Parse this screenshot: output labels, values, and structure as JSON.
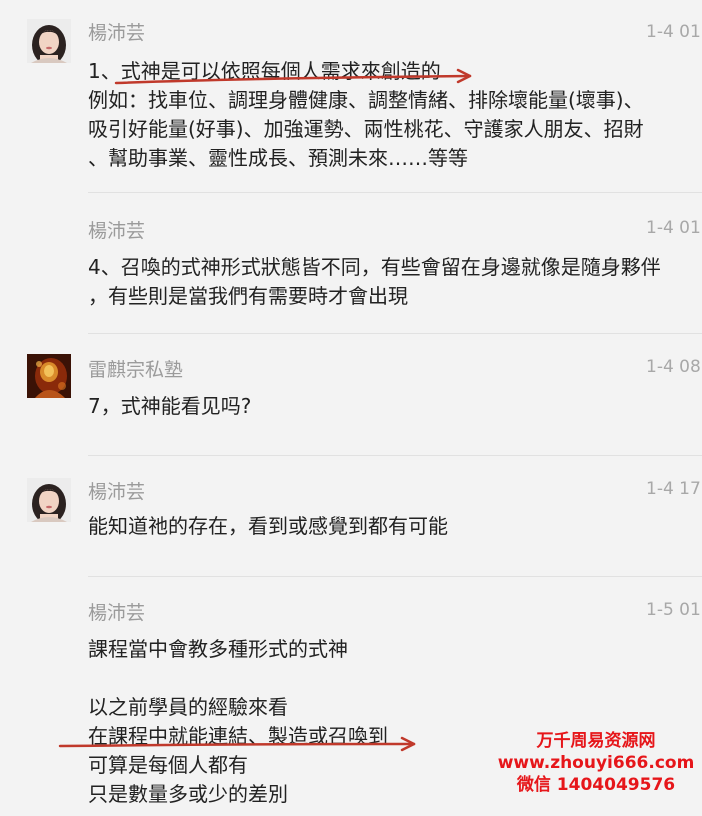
{
  "colors": {
    "background": "#f3f3f3",
    "sender": "#9b9b9b",
    "text": "#222222",
    "annotation_red": "#c0392b",
    "watermark_red": "#e6161a"
  },
  "messages": [
    {
      "sender": "楊沛芸",
      "time": "1-4 01:",
      "avatar": "woman-avatar",
      "lines": [
        "1、式神是可以依照每個人需求來創造的",
        "例如：找車位、調理身體健康、調整情緒、排除壞能量(壞事)、",
        "吸引好能量(好事)、加強運勢、兩性桃花、守護家人朋友、招財",
        "、幫助事業、靈性成長、預測未來……等等"
      ]
    },
    {
      "sender": "楊沛芸",
      "time": "1-4 01:",
      "avatar": "none",
      "lines": [
        "4、召喚的式神形式狀態皆不同，有些會留在身邊就像是隨身夥伴",
        "，有些則是當我們有需要時才會出現"
      ]
    },
    {
      "sender": "雷麒宗私塾",
      "time": "1-4 08:",
      "avatar": "golden-statue-avatar",
      "lines": [
        "7，式神能看见吗?"
      ]
    },
    {
      "sender": "楊沛芸",
      "time": "1-4 17:",
      "avatar": "woman-avatar",
      "lines": [
        "能知道祂的存在，看到或感覺到都有可能"
      ]
    },
    {
      "sender": "楊沛芸",
      "time": "1-5 01:",
      "avatar": "none",
      "lines": [
        "課程當中會教多種形式的式神",
        "",
        "以之前學員的經驗來看",
        "在課程中就能連結、製造或召喚到",
        "可算是每個人都有",
        "只是數量多或少的差別"
      ]
    }
  ],
  "watermark": {
    "line1": "万千周易资源网",
    "line2": "www.zhouyi666.com",
    "line3": "微信 1404049576"
  }
}
